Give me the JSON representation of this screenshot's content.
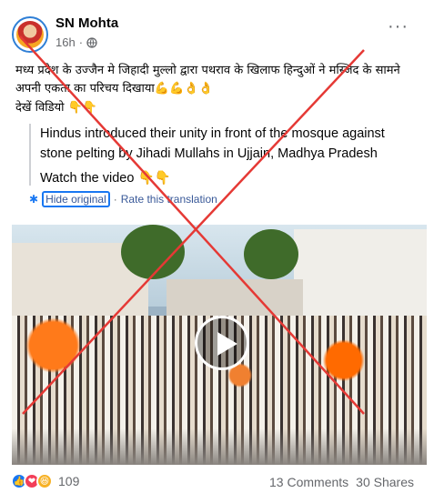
{
  "post": {
    "author": "SN Mohta",
    "time": "16h",
    "privacy_icon": "globe-icon",
    "more_icon": "more-options-icon",
    "text_line1": "मध्य प्रदेश के उज्जैन मे जिहादी मुल्लो द्वारा पथराव के खिलाफ हिन्दुओं ने मस्जिद के सामने अपनी एकता का परिचय दिखाया💪💪👌👌",
    "text_line2": "देखें विडियो 👇👇",
    "translation": {
      "text": "Hindus introduced their unity in front of the mosque against stone pelting by Jihadi Mullahs in Ujjain, Madhya Pradesh",
      "watch": "Watch the video 👇👇",
      "settings_icon": "gear-icon",
      "hide_label": "Hide original",
      "separator": "·",
      "rate_label": "Rate this translation"
    },
    "video": {
      "play_icon": "play-icon"
    },
    "overlay_color": "#e53935"
  },
  "footer": {
    "reaction_icons": [
      "like-icon",
      "love-icon",
      "haha-icon"
    ],
    "reaction_count": "109",
    "comments": "13 Comments",
    "shares": "30 Shares"
  }
}
